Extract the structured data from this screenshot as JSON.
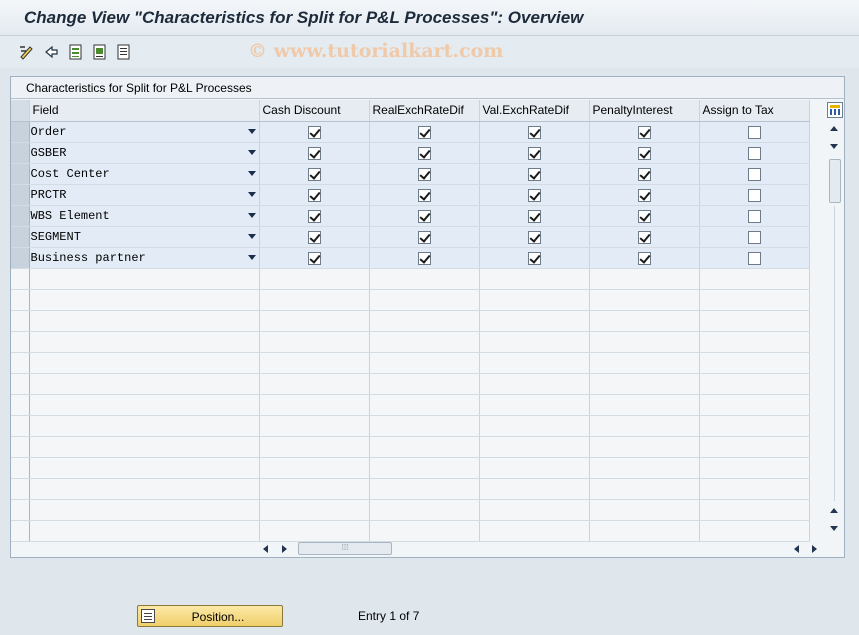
{
  "window": {
    "title": "Change View \"Characteristics for Split for P&L Processes\": Overview",
    "watermark": "© www.tutorialkart.com"
  },
  "toolbar": {
    "icons": [
      "display-change-icon",
      "refresh-icon",
      "select-all-icon",
      "select-block-icon",
      "deselect-all-icon"
    ]
  },
  "panel": {
    "title": "Characteristics for Split for P&L Processes"
  },
  "table": {
    "columns": [
      "Field",
      "Cash Discount",
      "RealExchRateDif",
      "Val.ExchRateDif",
      "PenaltyInterest",
      "Assign to Tax"
    ],
    "rows": [
      {
        "field": "Order",
        "checks": [
          true,
          true,
          true,
          true,
          false
        ]
      },
      {
        "field": "GSBER",
        "checks": [
          true,
          true,
          true,
          true,
          false
        ]
      },
      {
        "field": "Cost Center",
        "checks": [
          true,
          true,
          true,
          true,
          false
        ]
      },
      {
        "field": "PRCTR",
        "checks": [
          true,
          true,
          true,
          true,
          false
        ]
      },
      {
        "field": "WBS Element",
        "checks": [
          true,
          true,
          true,
          true,
          false
        ]
      },
      {
        "field": "SEGMENT",
        "checks": [
          true,
          true,
          true,
          true,
          false
        ]
      },
      {
        "field": "Business partner",
        "checks": [
          true,
          true,
          true,
          true,
          false
        ]
      }
    ],
    "empty_rows": 13
  },
  "footer": {
    "position_label": "Position...",
    "entry_text": "Entry 1 of 7"
  }
}
